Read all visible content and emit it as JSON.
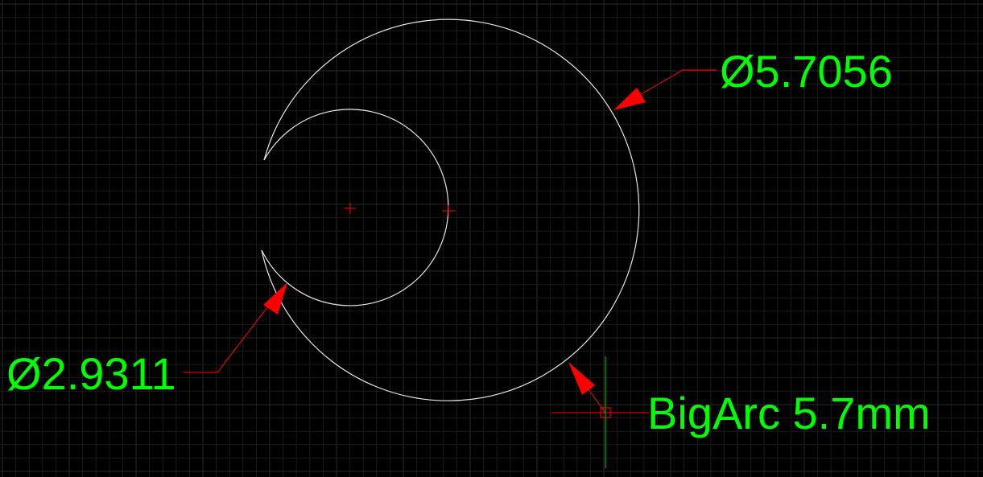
{
  "canvas": {
    "background_color": "#000000",
    "grid_color_minor": "#1a1a1a",
    "grid_color_major": "#2a2a2a",
    "geometry_color": "#e6e6e6",
    "dimension_line_color": "#ff0000",
    "text_color": "#00ff00",
    "cursor_x_axis_color": "#ff0000",
    "cursor_y_axis_color": "#00cc00"
  },
  "dimensions": {
    "big_arc": {
      "text": "Ø5.7056"
    },
    "small_arc": {
      "text": "Ø2.9311"
    }
  },
  "annotations": {
    "mleader": {
      "text": "BigArc 5.7mm"
    }
  }
}
